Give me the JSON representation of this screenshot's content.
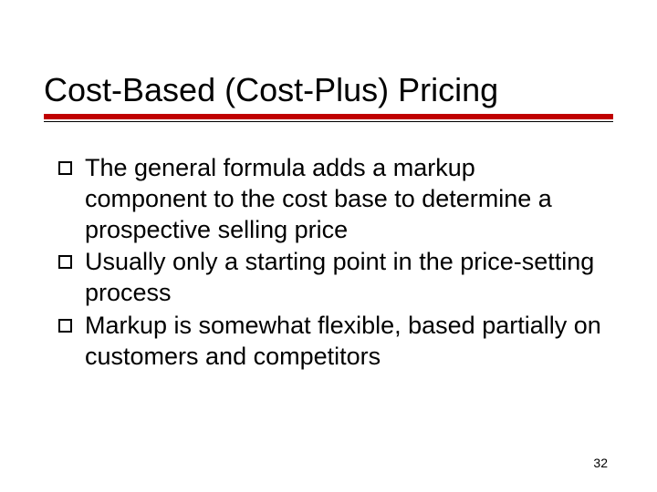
{
  "slide": {
    "title": "Cost-Based (Cost-Plus) Pricing",
    "bullets": [
      "The general formula adds a markup component to the cost base to determine a prospective selling price",
      "Usually only a starting point in the price-setting process",
      "Markup is somewhat flexible, based partially on customers and competitors"
    ],
    "page_number": "32"
  },
  "colors": {
    "accent": "#c00000"
  }
}
